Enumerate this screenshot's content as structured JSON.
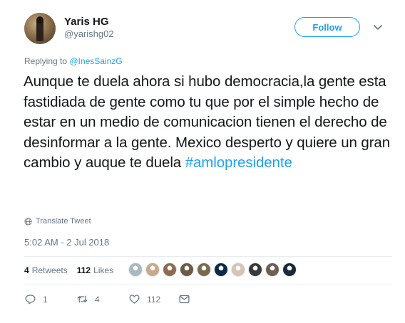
{
  "author": {
    "name": "Yaris HG",
    "handle": "@yarishg02"
  },
  "follow_label": "Follow",
  "reply": {
    "prefix": "Replying to ",
    "target": "@InesSainzG"
  },
  "tweet": {
    "body": "Aunque te duela ahora si hubo democracia,la gente esta fastidiada de gente como tu que por el simple hecho de estar en un medio de comunicacion tienen el derecho de desinformar a la gente. Mexico desperto y quiere un gran cambio y auque te duela ",
    "hashtag": "#amlopresidente"
  },
  "translate_label": "Translate Tweet",
  "timestamp": "5:02 AM - 2 Jul 2018",
  "stats": {
    "retweets_count": "4",
    "retweets_label": "Retweets",
    "likes_count": "112",
    "likes_label": "Likes"
  },
  "liker_avatars": [
    {
      "icon": "default-avatar-icon",
      "color": "#aab8c2"
    },
    {
      "icon": "user-avatar-icon",
      "color": "#c9a98b"
    },
    {
      "icon": "user-avatar-icon",
      "color": "#8c6d52"
    },
    {
      "icon": "user-avatar-icon",
      "color": "#6b5a46"
    },
    {
      "icon": "user-avatar-icon",
      "color": "#7a6a4c"
    },
    {
      "icon": "user-avatar-icon",
      "color": "#0b2a4a"
    },
    {
      "icon": "user-avatar-icon",
      "color": "#d6c3b2"
    },
    {
      "icon": "user-avatar-icon",
      "color": "#3a3a3a"
    },
    {
      "icon": "user-avatar-icon",
      "color": "#6d5f52"
    },
    {
      "icon": "user-avatar-icon",
      "color": "#1a2a3a"
    }
  ],
  "actions": {
    "reply_count": "1",
    "retweet_count": "4",
    "like_count": "112"
  },
  "colors": {
    "accent": "#1da1f2",
    "secondary_text": "#657786",
    "primary_text": "#14171a"
  }
}
